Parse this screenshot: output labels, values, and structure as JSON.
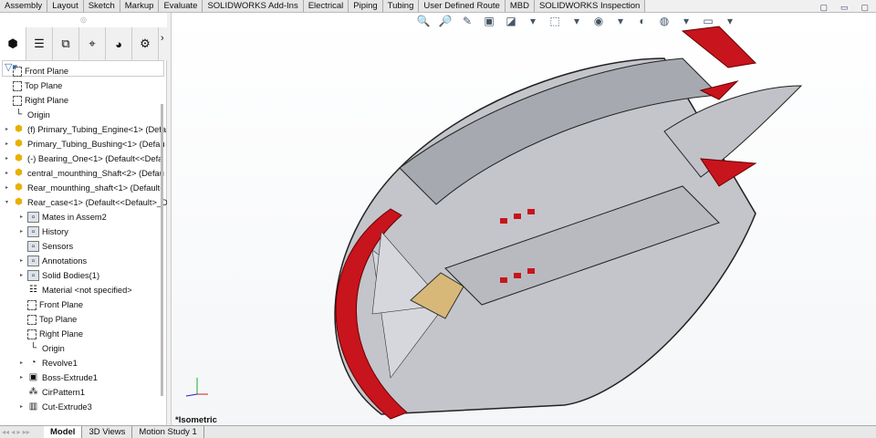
{
  "command_tabs": [
    "Assembly",
    "Layout",
    "Sketch",
    "Markup",
    "Evaluate",
    "SOLIDWORKS Add-Ins",
    "Electrical",
    "Piping",
    "Tubing",
    "User Defined Route",
    "MBD",
    "SOLIDWORKS Inspection"
  ],
  "manager_tabs": [
    {
      "icon": "feature-manager-icon",
      "glyph": "⬢"
    },
    {
      "icon": "property-manager-icon",
      "glyph": "☰"
    },
    {
      "icon": "configuration-manager-icon",
      "glyph": "⧉"
    },
    {
      "icon": "dimxpert-icon",
      "glyph": "⌖"
    },
    {
      "icon": "display-manager-icon",
      "glyph": "◕"
    },
    {
      "icon": "cam-icon",
      "glyph": "⚙"
    }
  ],
  "filter_icon": "▽▾",
  "tree": [
    {
      "label": "Front Plane",
      "icon": "plane",
      "level": 0,
      "expand": false
    },
    {
      "label": "Top Plane",
      "icon": "plane",
      "level": 0,
      "expand": false
    },
    {
      "label": "Right Plane",
      "icon": "plane",
      "level": 0,
      "expand": false
    },
    {
      "label": "Origin",
      "icon": "origin",
      "level": 0,
      "expand": false
    },
    {
      "label": "(f) Primary_Tubing_Engine<1> (Defa",
      "icon": "part",
      "level": 0,
      "expand": "▸"
    },
    {
      "label": "Primary_Tubing_Bushing<1> (Defau",
      "icon": "part",
      "level": 0,
      "expand": "▸"
    },
    {
      "label": "(-) Bearing_One<1> (Default<<Defa",
      "icon": "part",
      "level": 0,
      "expand": "▸"
    },
    {
      "label": "central_mounthing_Shaft<2> (Defau",
      "icon": "part",
      "level": 0,
      "expand": "▸"
    },
    {
      "label": "Rear_mounthing_shaft<1> (Default-",
      "icon": "part",
      "level": 0,
      "expand": "▸"
    },
    {
      "label": "Rear_case<1> (Default<<Default>_D",
      "icon": "part",
      "level": 0,
      "expand": "▾"
    },
    {
      "label": "Mates in Assem2",
      "icon": "folder",
      "level": 1,
      "expand": "▸"
    },
    {
      "label": "History",
      "icon": "folder",
      "level": 1,
      "expand": "▸"
    },
    {
      "label": "Sensors",
      "icon": "folder",
      "level": 1,
      "expand": false
    },
    {
      "label": "Annotations",
      "icon": "folder",
      "level": 1,
      "expand": "▸"
    },
    {
      "label": "Solid Bodies(1)",
      "icon": "folder",
      "level": 1,
      "expand": "▸"
    },
    {
      "label": "Material <not specified>",
      "icon": "material",
      "level": 1,
      "expand": false
    },
    {
      "label": "Front Plane",
      "icon": "plane",
      "level": 1,
      "expand": false
    },
    {
      "label": "Top Plane",
      "icon": "plane",
      "level": 1,
      "expand": false
    },
    {
      "label": "Right Plane",
      "icon": "plane",
      "level": 1,
      "expand": false
    },
    {
      "label": "Origin",
      "icon": "origin",
      "level": 1,
      "expand": false
    },
    {
      "label": "Revolve1",
      "icon": "revolve",
      "level": 1,
      "expand": "▸"
    },
    {
      "label": "Boss-Extrude1",
      "icon": "extrude",
      "level": 1,
      "expand": "▸"
    },
    {
      "label": "CirPattern1",
      "icon": "pattern",
      "level": 1,
      "expand": false
    },
    {
      "label": "Cut-Extrude3",
      "icon": "cut",
      "level": 1,
      "expand": "▸"
    }
  ],
  "bottom_tabs": [
    "Model",
    "3D Views",
    "Motion Study 1"
  ],
  "view_label": "*Isometric",
  "hud_icons": [
    "🔍",
    "🔎",
    "✎",
    "▣",
    "◪",
    "▾",
    "⬚",
    "▾",
    "◉",
    "▾",
    "◐",
    "◍",
    "▾",
    "▭",
    "▾"
  ],
  "window_controls": [
    "▢",
    "▭",
    "▢"
  ],
  "colors": {
    "accent_red": "#c8141c",
    "body_gray": "#b4b6bc",
    "brass": "#d8b878"
  }
}
